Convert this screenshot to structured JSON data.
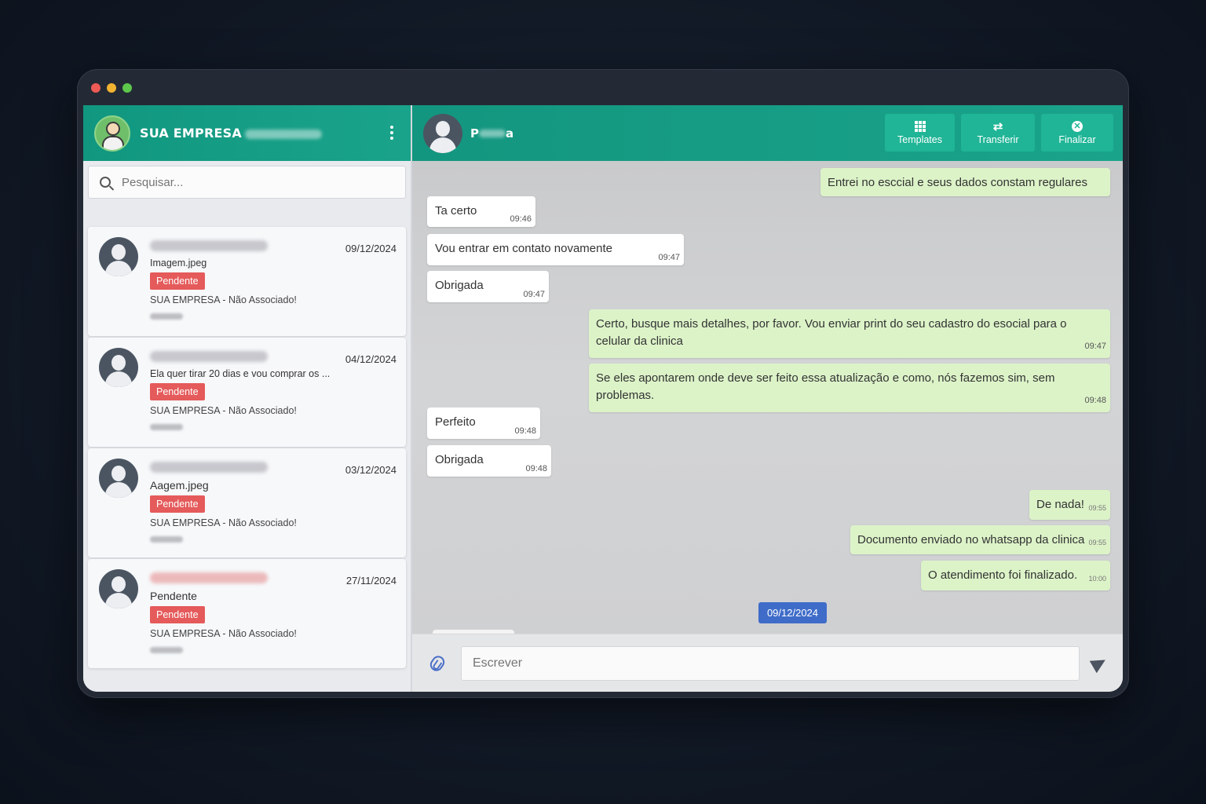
{
  "sidebar": {
    "company": "SUA EMPRESA",
    "search_placeholder": "Pesquisar...",
    "conversations": [
      {
        "date": "09/12/2024",
        "preview": "Imagem.jpeg",
        "status": "Pendente",
        "company": "SUA EMPRESA - Não Associado!"
      },
      {
        "date": "04/12/2024",
        "preview": "Ela quer tirar 20 dias e vou comprar os ...",
        "status": "Pendente",
        "company": "SUA EMPRESA - Não Associado!"
      },
      {
        "date": "03/12/2024",
        "preview": "Aagem.jpeg",
        "status": "Pendente",
        "company": "SUA EMPRESA - Não Associado!"
      },
      {
        "date": "27/11/2024",
        "preview": "Pendente",
        "status": "Pendente",
        "company": "SUA EMPRESA - Não Associado!"
      }
    ]
  },
  "chat": {
    "contact_initial": "P",
    "contact_suffix": "a",
    "actions": {
      "templates": "Templates",
      "transfer": "Transferir",
      "finish": "Finalizar"
    },
    "messages": [
      {
        "dir": "out",
        "text": "Entrei no esccial e seus dados constam regulares",
        "time": ""
      },
      {
        "dir": "in",
        "text": "Ta certo",
        "time": "09:46"
      },
      {
        "dir": "in",
        "text": "Vou entrar em contato novamente",
        "time": "09:47"
      },
      {
        "dir": "in",
        "text": "Obrigada",
        "time": "09:47"
      },
      {
        "dir": "out",
        "text": "Certo, busque mais detalhes, por favor. Vou enviar print do seu cadastro do esocial para o celular da clinica",
        "time": "09:47"
      },
      {
        "dir": "out",
        "text": "Se eles apontarem onde deve ser feito essa atualização e como, nós fazemos sim, sem problemas.",
        "time": "09:48"
      },
      {
        "dir": "in",
        "text": "Perfeito",
        "time": "09:48"
      },
      {
        "dir": "in",
        "text": "Obrigada",
        "time": "09:48"
      },
      {
        "dir": "out",
        "text": "De nada!",
        "time": "09:55"
      },
      {
        "dir": "out",
        "text": "Documento enviado no whatsapp da clinica",
        "time": "09:55"
      },
      {
        "dir": "out",
        "text": "O atendimento foi finalizado.",
        "time": "10:00"
      }
    ],
    "date_separator": "09/12/2024",
    "composer_placeholder": "Escrever"
  }
}
